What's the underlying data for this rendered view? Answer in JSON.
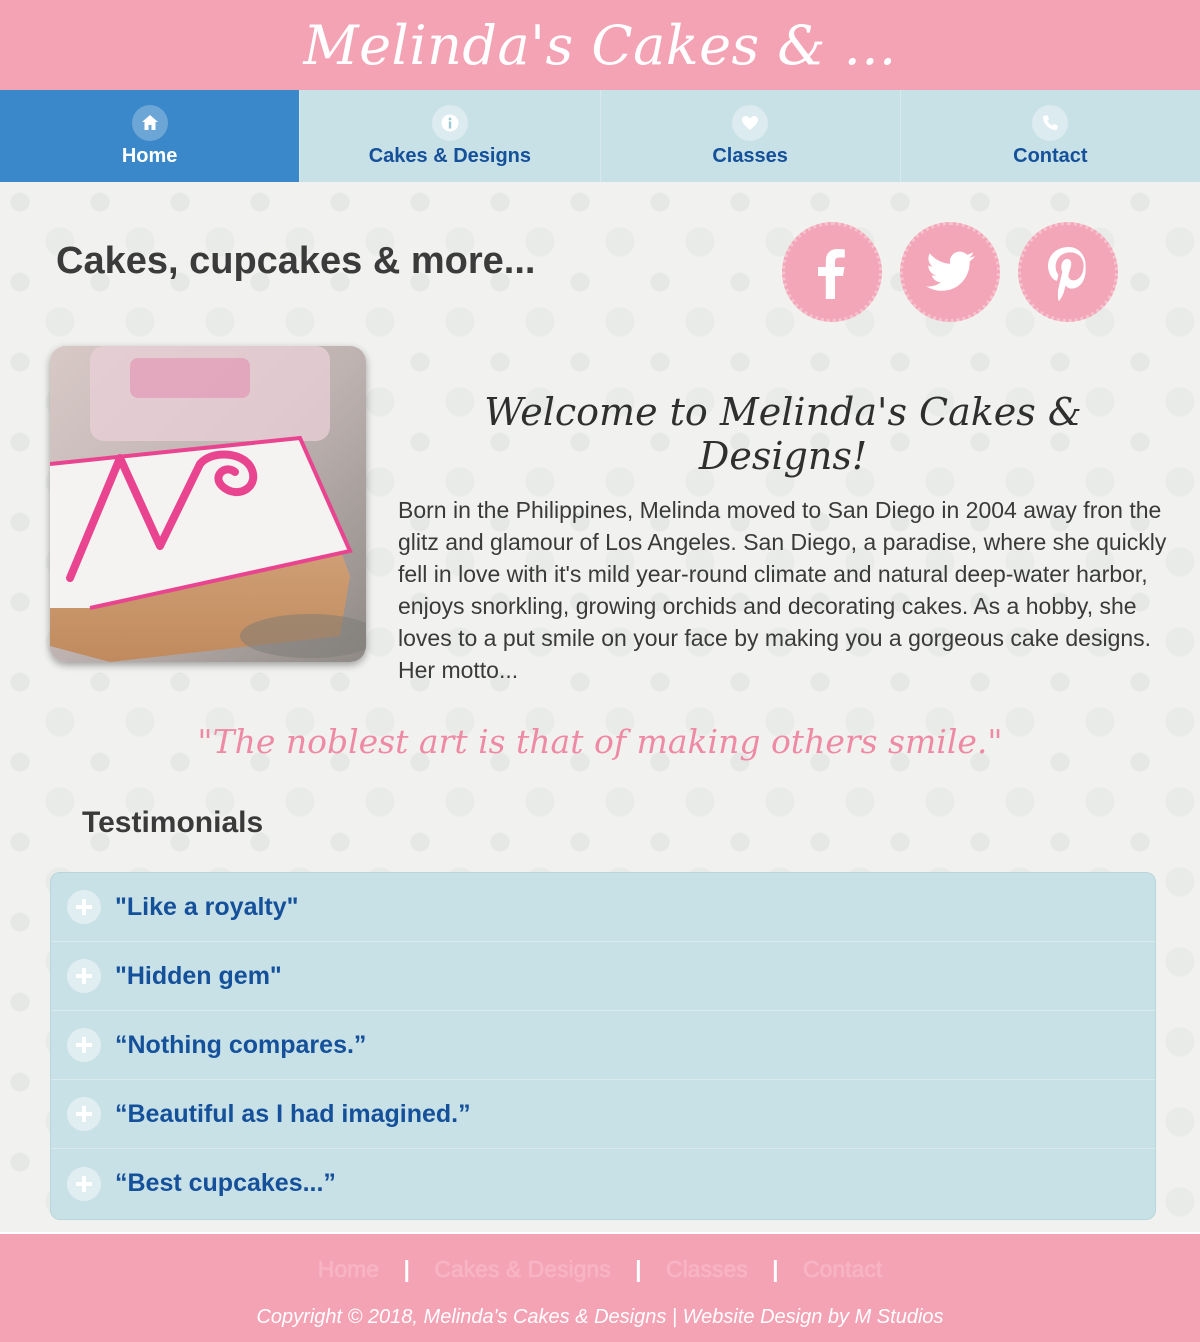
{
  "header": {
    "brand": "Melinda's Cakes & ..."
  },
  "nav": {
    "items": [
      {
        "label": "Home",
        "icon": "home-icon"
      },
      {
        "label": "Cakes & Designs",
        "icon": "info-icon"
      },
      {
        "label": "Classes",
        "icon": "heart-icon"
      },
      {
        "label": "Contact",
        "icon": "phone-icon"
      }
    ]
  },
  "main": {
    "title": "Cakes, cupcakes & more...",
    "social": [
      "facebook-icon",
      "twitter-icon",
      "pinterest-icon"
    ],
    "welcome": "Welcome to Melinda's Cakes & Designs!",
    "bio": "Born in the Philippines, Melinda moved to San Diego in 2004 away fron the glitz and glamour of Los Angeles. San Diego, a paradise, where she quickly fell in love with it's mild year-round climate and natural deep-water harbor, enjoys snorkling, growing orchids and decorating cakes. As a hobby, she loves to a put smile on your face by making you a gorgeous cake designs. Her motto...",
    "motto": "\"The noblest art is that of making others smile.\""
  },
  "testimonials": {
    "heading": "Testimonials",
    "items": [
      "\"Like a royalty\"",
      "\"Hidden gem\"",
      "“Nothing compares.”",
      "“Beautiful as I had imagined.”",
      "“Best cupcakes...”"
    ]
  },
  "footer": {
    "links": [
      "Home",
      "Cakes & Designs",
      "Classes",
      "Contact"
    ],
    "separator": "|",
    "copyright": "Copyright © 2018, Melinda's Cakes & Designs | Website Design by M Studios"
  },
  "colors": {
    "header_pink": "#f4a3b5",
    "nav_blue": "#c8e1e6",
    "nav_active": "#3a88c9",
    "link_blue": "#15509a",
    "motto_pink": "#ef8aa5"
  }
}
